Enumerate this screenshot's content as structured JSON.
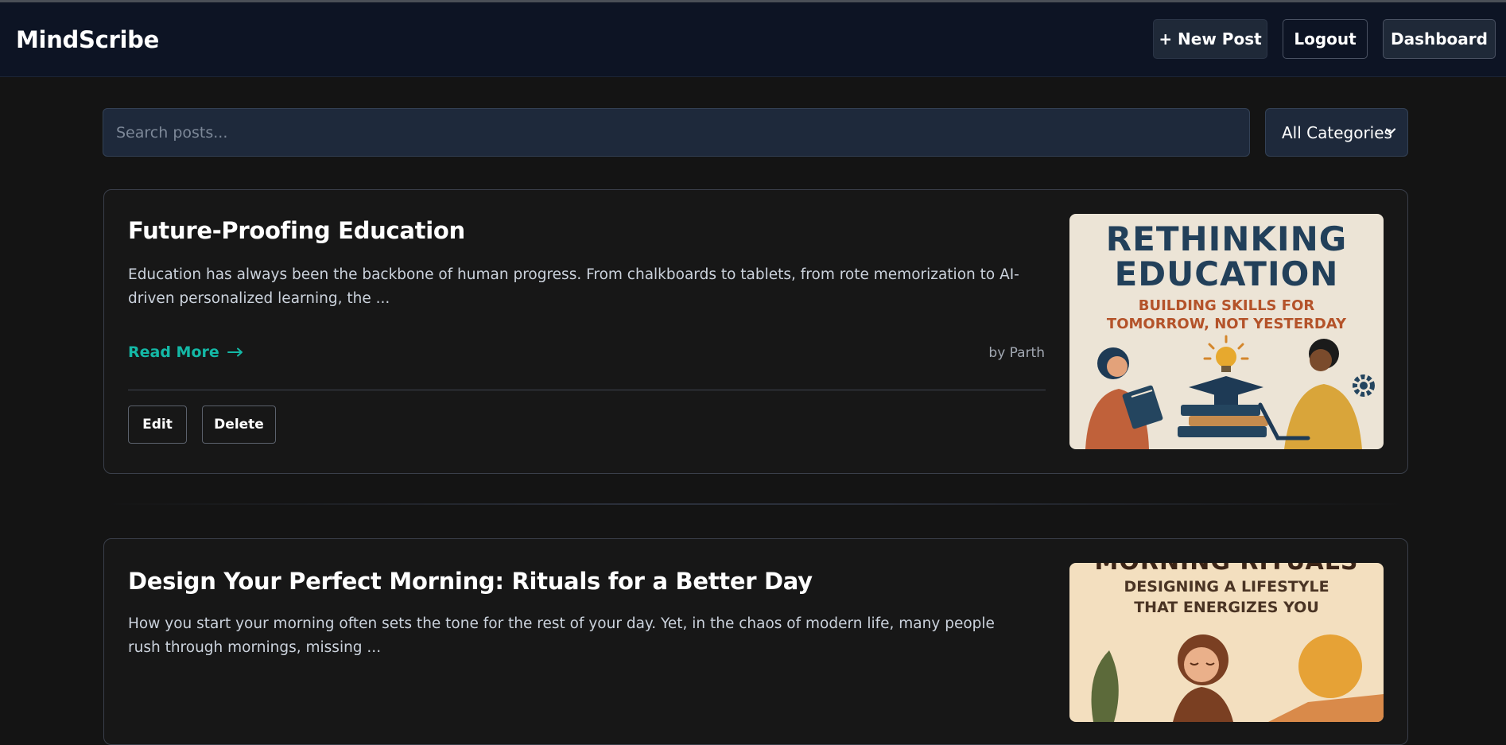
{
  "app": {
    "brand": "MindScribe"
  },
  "header": {
    "new_post_label": "+ New Post",
    "logout_label": "Logout",
    "dashboard_label": "Dashboard"
  },
  "filters": {
    "search_placeholder": "Search posts...",
    "category_selected": "All Categories"
  },
  "posts": [
    {
      "title": "Future-Proofing Education",
      "excerpt": "Education has always been the backbone of human progress. From chalkboards to tablets, from rote memorization to AI-driven personalized learning, the ...",
      "read_more": "Read More",
      "author": "by Parth",
      "edit_label": "Edit",
      "delete_label": "Delete",
      "image": {
        "heading_line1": "RETHINKING",
        "heading_line2": "EDUCATION",
        "sub_line1": "BUILDING SKILLS FOR",
        "sub_line2": "TOMORROW, NOT YESTERDAY"
      }
    },
    {
      "title": "Design Your Perfect Morning: Rituals for a Better Day",
      "excerpt": "How you start your morning often sets the tone for the rest of your day. Yet, in the chaos of modern life, many people rush through mornings, missing ...",
      "image": {
        "heading": "MORNING RITUALS",
        "sub_line1": "DESIGNING A LIFESTYLE",
        "sub_line2": "THAT ENERGIZES YOU"
      }
    }
  ],
  "colors": {
    "accent": "#14b8a6",
    "header_bg": "#0d1424",
    "page_bg": "#141414",
    "input_bg": "#1e293b"
  },
  "icons": {
    "read_more": "arrow-right-icon",
    "select": "chevron-down-icon"
  }
}
